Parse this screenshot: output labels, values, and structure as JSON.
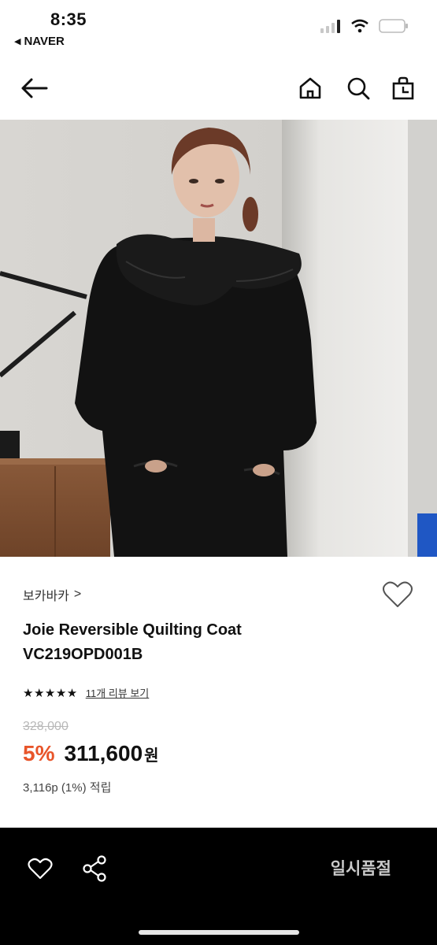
{
  "status_bar": {
    "time": "8:35",
    "back_app": "NAVER"
  },
  "header": {
    "back_icon": "arrow-left-icon",
    "home_icon": "home-icon",
    "search_icon": "search-icon",
    "cart_icon": "shopping-bag-icon"
  },
  "product": {
    "brand": "보카바카",
    "brand_chevron": ">",
    "title_line1": "Joie Reversible Quilting Coat",
    "title_line2": "VC219OPD001B",
    "stars_text": "★★★★★",
    "rating_value": 5,
    "review_link": "11개 리뷰 보기",
    "original_price": "328,000",
    "discount": "5%",
    "price": "311,600",
    "currency": "원",
    "points": "3,116p (1%) 적립"
  },
  "bottom_bar": {
    "wishlist_icon": "heart-outline-icon",
    "share_icon": "share-icon",
    "status_label": "일시품절"
  },
  "colors": {
    "accent_discount": "#e8552a",
    "bottom_bar_bg": "#000000",
    "soldout_text": "#c9c9c9",
    "original_price": "#b8b8b8"
  }
}
